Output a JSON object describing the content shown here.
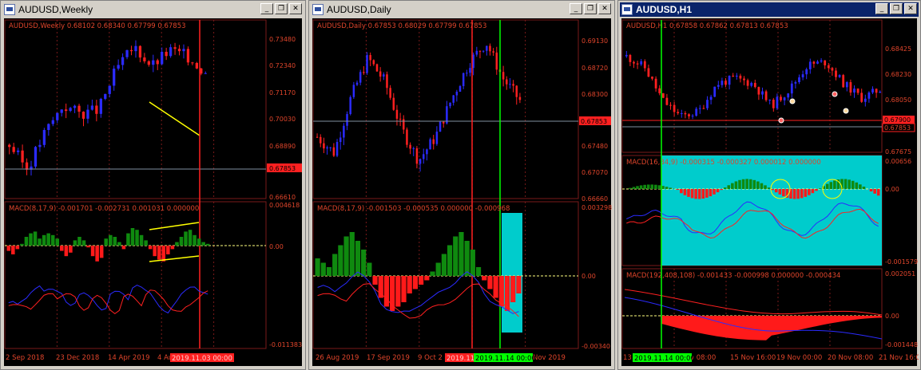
{
  "colors": {
    "up": "#2b2bff",
    "down": "#ff2020",
    "axis": "#e0452b",
    "hist_up": "#0f8a0f",
    "hist_down": "#ff1a1a",
    "cyan": "#00cccc",
    "green_line": "#00ff00",
    "red_line": "#ff2020",
    "yellow": "#ffff00"
  },
  "windows": [
    {
      "title": "AUDUSD,Weekly",
      "active": false,
      "price_label": "AUDUSD,Weekly  0.68102 0.68340 0.67799 0.67853",
      "price_ticks": [
        "0.73480",
        "0.72340",
        "0.71170",
        "0.70030",
        "0.68890",
        "0.67853",
        "0.66610"
      ],
      "current_price": "0.67853",
      "macd_label": "MACD(8,17,9) -0.001701 -0.002731 0.001031 0.000000",
      "macd_ticks": [
        "0.004618",
        "0.00",
        "-0.011383"
      ],
      "dates": [
        "2 Sep 2018",
        "23 Dec 2018",
        "14 Apr 2019",
        "4 Au"
      ],
      "date_tag": "2019.11.03 00:00",
      "series": {
        "seed": 3,
        "count": 46,
        "trend": [
          0.3,
          0.15,
          0.38,
          0.55,
          0.5,
          0.52,
          0.78,
          0.92,
          0.8,
          0.9,
          0.86,
          0.76
        ],
        "hist": [
          -0.3,
          -0.5,
          -0.2,
          0.1,
          0.5,
          0.7,
          0.8,
          0.4,
          0.6,
          0.7,
          0.6,
          0.4,
          -0.3,
          -0.6,
          -0.4,
          0.3,
          0.5,
          0.3,
          -0.1,
          -0.6,
          -0.9,
          -0.7,
          0.4,
          0.6,
          0.5,
          0.2,
          -0.2,
          0.7,
          1.0,
          0.9,
          0.6,
          0.3,
          -0.2,
          -0.6,
          -0.8,
          -0.9,
          -0.5,
          -0.2,
          0.2,
          0.5,
          0.8,
          0.9,
          0.6,
          0.4,
          0.2,
          0.1
        ]
      }
    },
    {
      "title": "AUDUSD,Daily",
      "active": false,
      "price_label": "AUDUSD,Daily  0.67853 0.68029 0.67799 0.67853",
      "price_ticks": [
        "0.69130",
        "0.68720",
        "0.68300",
        "0.67853",
        "0.67480",
        "0.67070",
        "0.66660"
      ],
      "current_price": "0.67853",
      "macd_label": "MACD(8,17,9) -0.001503 -0.000535 0.000000 -0.000968",
      "macd_ticks": [
        "0.003298",
        "0.00",
        "-0.00340"
      ],
      "dates": [
        "26 Aug 2019",
        "17 Sep 2019",
        "9 Oct 2",
        "Nov 2019"
      ],
      "date_tag": "2019.11.",
      "date_tag2": "2019.11.14 00:00",
      "series": {
        "seed": 7,
        "count": 62,
        "trend": [
          0.35,
          0.25,
          0.6,
          0.85,
          0.7,
          0.4,
          0.2,
          0.35,
          0.6,
          0.82,
          0.95,
          0.72,
          0.58
        ],
        "hist": [
          0.4,
          0.3,
          0.2,
          0.5,
          0.7,
          0.9,
          1.0,
          0.8,
          0.6,
          0.3,
          -0.2,
          -0.5,
          -0.7,
          -0.8,
          -0.7,
          -0.6,
          -0.4,
          -0.3,
          -0.2,
          -0.1,
          0.1,
          0.3,
          0.5,
          0.7,
          0.9,
          1.0,
          0.8,
          0.6,
          0.2,
          -0.1,
          -0.3,
          -0.5,
          -0.7,
          -0.8,
          -0.6,
          -0.4
        ]
      }
    },
    {
      "title": "AUDUSD,H1",
      "active": true,
      "price_label": "AUDUSD,H1  0.67858 0.67862 0.67813 0.67853",
      "price_ticks": [
        "0.68425",
        "0.68230",
        "0.68050",
        "0.67900",
        "0.67853",
        "0.67675"
      ],
      "current_price": "0.67853",
      "current_price2": "0.67900",
      "macd_label": "MACD(16,34,9) -0.000315 -0.000327 0.000012 0.000000",
      "macd_ticks": [
        "0.00656",
        "0.00",
        "-0.001579"
      ],
      "macd2_label": "MACD(192,408,108) -0.001433 -0.000998 0.000000 -0.000434",
      "macd2_ticks": [
        "0.002051",
        "0.00",
        "-0.001448"
      ],
      "dates": [
        "13",
        "v 08:00",
        "15 Nov 16:00",
        "19 Nov 00:00",
        "20 Nov 08:00",
        "21 Nov 16:0"
      ],
      "date_tag": "2019.11.14 00:00",
      "series": {
        "seed": 11,
        "count": 70,
        "trend": [
          0.8,
          0.7,
          0.4,
          0.25,
          0.3,
          0.55,
          0.6,
          0.55,
          0.35,
          0.5,
          0.72,
          0.75,
          0.55,
          0.42,
          0.5
        ]
      }
    }
  ]
}
